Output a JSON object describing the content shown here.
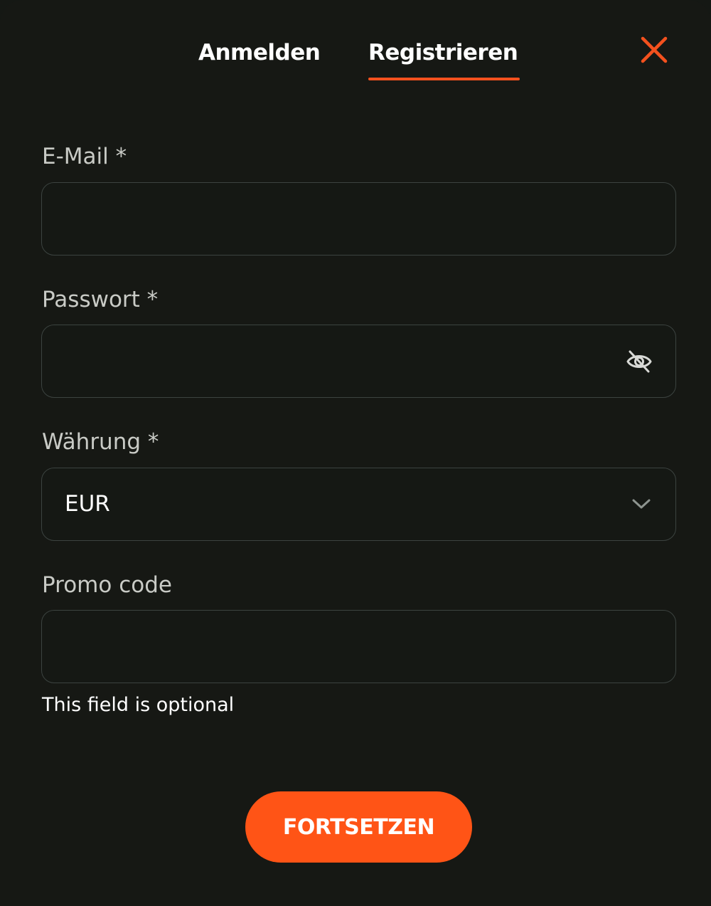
{
  "tabs": [
    {
      "label": "Anmelden",
      "active": false
    },
    {
      "label": "Registrieren",
      "active": true
    }
  ],
  "accent_color": "#f4511e",
  "close_icon": "close-icon",
  "form": {
    "email": {
      "label": "E-Mail *",
      "value": ""
    },
    "password": {
      "label": "Passwort *",
      "value": "",
      "toggle_icon": "eye-slash-icon"
    },
    "currency": {
      "label": "Währung *",
      "value": "EUR",
      "icon": "chevron-down-icon"
    },
    "promo": {
      "label": "Promo code",
      "value": "",
      "helper": "This field is optional"
    }
  },
  "submit_label": "FORTSETZEN"
}
